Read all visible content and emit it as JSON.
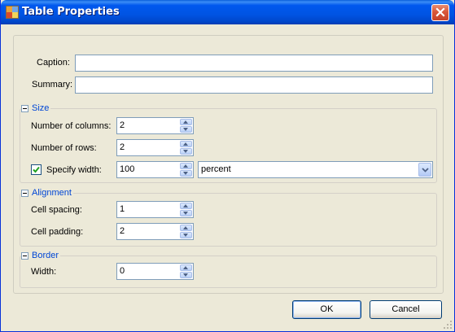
{
  "window": {
    "title": "Table Properties",
    "icons": {
      "app": "table-app-icon",
      "close": "close-x-icon"
    }
  },
  "caption": {
    "label": "Caption:",
    "value": ""
  },
  "summary": {
    "label": "Summary:",
    "value": ""
  },
  "size": {
    "title": "Size",
    "columns": {
      "label": "Number of columns:",
      "value": "2"
    },
    "rows": {
      "label": "Number of rows:",
      "value": "2"
    },
    "specify_width": {
      "label": "Specify width:",
      "checked": true,
      "value": "100",
      "unit": "percent"
    }
  },
  "alignment": {
    "title": "Alignment",
    "cell_spacing": {
      "label": "Cell spacing:",
      "value": "1"
    },
    "cell_padding": {
      "label": "Cell padding:",
      "value": "2"
    }
  },
  "border": {
    "title": "Border",
    "width": {
      "label": "Width:",
      "value": "0"
    }
  },
  "buttons": {
    "ok": "OK",
    "cancel": "Cancel"
  },
  "colors": {
    "titlebar": "#0054e3",
    "group_title": "#0046d5",
    "dialog_bg": "#ece9d8"
  }
}
